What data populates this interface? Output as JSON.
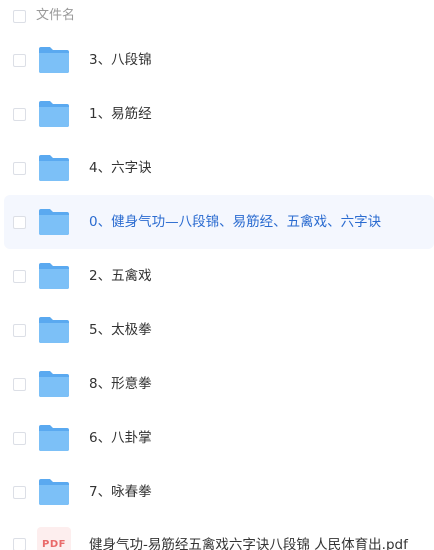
{
  "header": {
    "label": "文件名"
  },
  "rows": [
    {
      "name": "3、八段锦",
      "type": "folder"
    },
    {
      "name": "1、易筋经",
      "type": "folder"
    },
    {
      "name": "4、六字诀",
      "type": "folder"
    },
    {
      "name": "0、健身气功—八段锦、易筋经、五禽戏、六字诀",
      "type": "folder",
      "selected": true
    },
    {
      "name": "2、五禽戏",
      "type": "folder"
    },
    {
      "name": "5、太极拳",
      "type": "folder"
    },
    {
      "name": "8、形意拳",
      "type": "folder"
    },
    {
      "name": "6、八卦掌",
      "type": "folder"
    },
    {
      "name": "7、咏春拳",
      "type": "folder"
    },
    {
      "name": "健身气功-易筋经五禽戏六字诀八段锦 人民体育出.pdf",
      "type": "pdf",
      "icon_text": "PDF"
    }
  ],
  "colors": {
    "folder": "#5aa9f0",
    "folder_tab": "#7cc0f7",
    "selected_text": "#2a6bd0",
    "selected_bg": "#f4f7fe",
    "pdf_text": "#e96a6a"
  }
}
